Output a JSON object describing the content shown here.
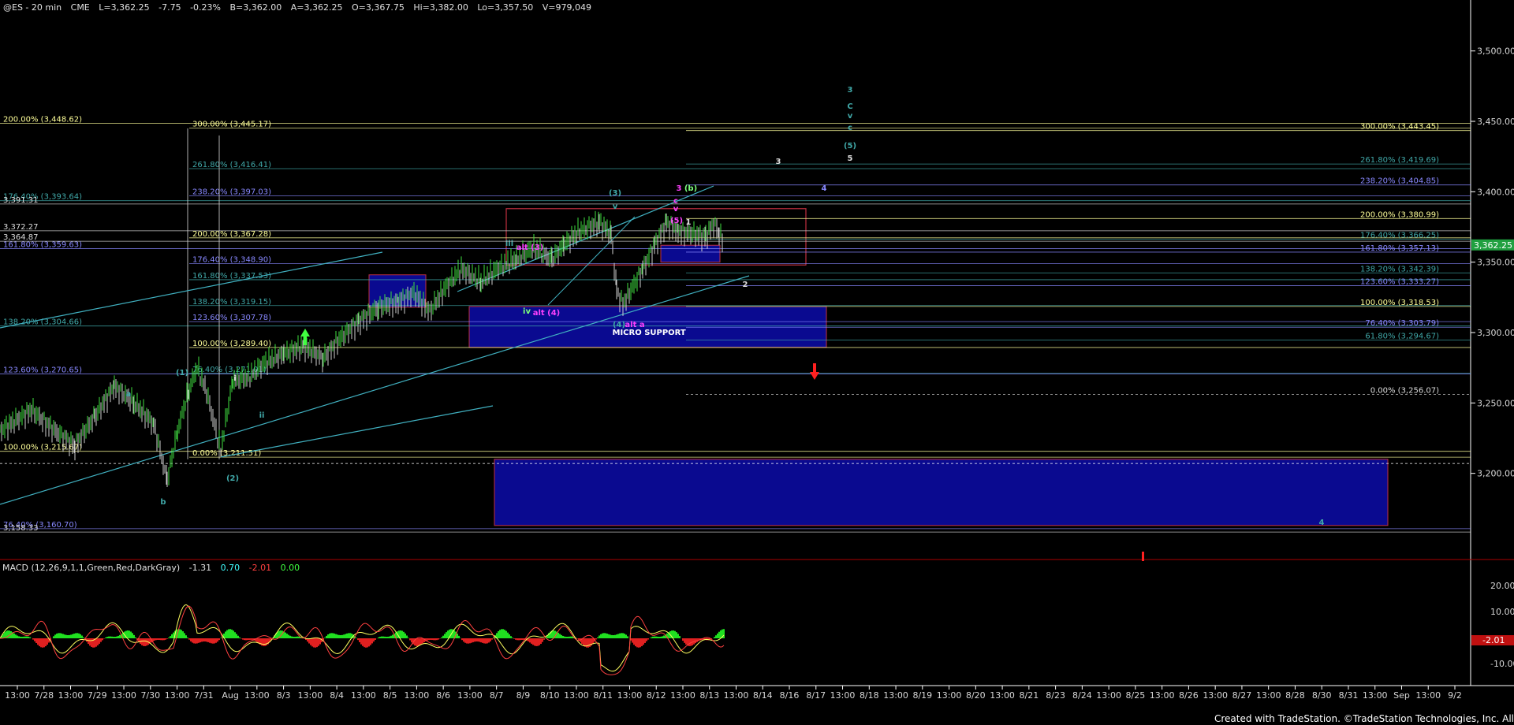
{
  "header": {
    "symbol": "@ES - 20 min",
    "exchange": "CME",
    "last": "L=3,362.25",
    "change": "-7.75",
    "change_pct": "-0.23%",
    "bid": "B=3,362.00",
    "ask": "A=3,362.25",
    "open": "O=3,367.75",
    "high": "Hi=3,382.00",
    "low": "Lo=3,357.50",
    "volume": "V=979,049"
  },
  "footer": {
    "credit": "Created with TradeStation. ©TradeStation Technologies, Inc. All rights reserved."
  },
  "macd": {
    "label": "MACD (12,26,9,1,1,Green,Red,DarkGray)",
    "v1": "-1.31",
    "v2": "0.70",
    "v3": "-2.01",
    "v4": "0.00",
    "current": "-2.01"
  },
  "colors": {
    "fib_yellow": "#ffff99",
    "fib_blue": "#8080ff",
    "fib_teal": "#40a0a0",
    "wave_cyan": "#5fd3e6",
    "wave_magenta": "#ff40ff",
    "wave_green": "#7cff7c",
    "zone_fill": "#0a0a90",
    "zone_border": "#c03040",
    "price_box": "#20a040"
  },
  "chart_data": {
    "type": "line",
    "title": "@ES - 20 min",
    "price_axis": {
      "ylim": [
        3150,
        3525
      ],
      "ticks": [
        "3,500.00",
        "3,450.00",
        "3,400.00",
        "3,350.00",
        "3,300.00",
        "3,250.00",
        "3,200.00"
      ],
      "current_price": "3,362.25"
    },
    "x_axis": {
      "labels": [
        "13:00",
        "7/28",
        "13:00",
        "7/29",
        "13:00",
        "7/30",
        "13:00",
        "7/31",
        "Aug",
        "13:00",
        "8/3",
        "13:00",
        "8/4",
        "13:00",
        "8/5",
        "13:00",
        "8/6",
        "13:00",
        "8/7",
        "8/9",
        "8/10",
        "13:00",
        "8/11",
        "13:00",
        "8/12",
        "13:00",
        "8/13",
        "13:00",
        "8/14",
        "8/16",
        "8/17",
        "13:00",
        "8/18",
        "13:00",
        "8/19",
        "13:00",
        "8/20",
        "13:00",
        "8/21",
        "8/23",
        "8/24",
        "13:00",
        "8/25",
        "13:00",
        "8/26",
        "13:00",
        "8/27",
        "13:00",
        "8/28",
        "8/30",
        "8/31",
        "13:00",
        "Sep",
        "13:00",
        "9/2"
      ]
    },
    "fib_levels": [
      {
        "label": "200.00% (3,448.62)",
        "price": 3448.62,
        "color": "yellow",
        "side": "left"
      },
      {
        "label": "300.00% (3,445.17)",
        "price": 3445.17,
        "color": "yellow",
        "side": "mid"
      },
      {
        "label": "261.80% (3,416.41)",
        "price": 3416.41,
        "color": "teal",
        "side": "mid"
      },
      {
        "label": "238.20% (3,397.03)",
        "price": 3397.03,
        "color": "blue",
        "side": "mid"
      },
      {
        "label": "176.40% (3,393.64)",
        "price": 3393.64,
        "color": "teal",
        "side": "left"
      },
      {
        "label": "3,391.31",
        "price": 3391.31,
        "color": "white",
        "side": "left"
      },
      {
        "label": "3,372.27",
        "price": 3372.27,
        "color": "white",
        "side": "left"
      },
      {
        "label": "200.00% (3,367.28)",
        "price": 3367.28,
        "color": "yellow",
        "side": "mid"
      },
      {
        "label": "3,364.87",
        "price": 3364.87,
        "color": "white",
        "side": "left"
      },
      {
        "label": "161.80% (3,359.63)",
        "price": 3359.63,
        "color": "blue",
        "side": "left"
      },
      {
        "label": "176.40% (3,348.90)",
        "price": 3348.9,
        "color": "blue",
        "side": "mid"
      },
      {
        "label": "161.80% (3,337.53)",
        "price": 3337.53,
        "color": "teal",
        "side": "mid"
      },
      {
        "label": "138.20% (3,319.15)",
        "price": 3319.15,
        "color": "teal",
        "side": "mid"
      },
      {
        "label": "123.60% (3,307.78)",
        "price": 3307.78,
        "color": "blue",
        "side": "mid"
      },
      {
        "label": "138.20% (3,304.66)",
        "price": 3304.66,
        "color": "teal",
        "side": "left"
      },
      {
        "label": "100.00% (3,289.40)",
        "price": 3289.4,
        "color": "yellow",
        "side": "mid"
      },
      {
        "label": "76.40% (3,271.01)",
        "price": 3271.01,
        "color": "teal",
        "side": "mid"
      },
      {
        "label": "123.60% (3,270.65)",
        "price": 3270.65,
        "color": "blue",
        "side": "left"
      },
      {
        "label": "100.00% (3,215.67)",
        "price": 3215.67,
        "color": "yellow",
        "side": "left"
      },
      {
        "label": "0.00% (3,211.51)",
        "price": 3211.51,
        "color": "yellow",
        "side": "mid"
      },
      {
        "label": "76.40% (3,160.70)",
        "price": 3160.7,
        "color": "blue",
        "side": "left"
      },
      {
        "label": "3,158.33",
        "price": 3158.33,
        "color": "white",
        "side": "left"
      },
      {
        "label": "300.00% (3,443.45)",
        "price": 3443.45,
        "color": "yellow",
        "side": "right"
      },
      {
        "label": "261.80% (3,419.69)",
        "price": 3419.69,
        "color": "teal",
        "side": "right"
      },
      {
        "label": "238.20% (3,404.85)",
        "price": 3404.85,
        "color": "blue",
        "side": "right"
      },
      {
        "label": "200.00% (3,380.99)",
        "price": 3380.99,
        "color": "yellow",
        "side": "right"
      },
      {
        "label": "176.40% (3,366.25)",
        "price": 3366.25,
        "color": "teal",
        "side": "right"
      },
      {
        "label": "161.80% (3,357.13)",
        "price": 3357.13,
        "color": "blue",
        "side": "right"
      },
      {
        "label": "138.20% (3,342.39)",
        "price": 3342.39,
        "color": "teal",
        "side": "right"
      },
      {
        "label": "123.60% (3,333.27)",
        "price": 3333.27,
        "color": "blue",
        "side": "right"
      },
      {
        "label": "100.00% (3,318.53)",
        "price": 3318.53,
        "color": "yellow",
        "side": "right"
      },
      {
        "label": "76.40% (3,303.79)",
        "price": 3303.79,
        "color": "blue",
        "side": "right"
      },
      {
        "label": "61.80% (3,294.67)",
        "price": 3294.67,
        "color": "teal",
        "side": "right"
      },
      {
        "label": "0.00% (3,256.07)",
        "price": 3256.07,
        "color": "white",
        "side": "right"
      }
    ],
    "zones": [
      {
        "label": "MICRO SUPPORT",
        "top": 3318.5,
        "bottom": 3289.5
      },
      {
        "label": "",
        "top": 3341,
        "bottom": 3318
      },
      {
        "label": "",
        "top": 3210,
        "bottom": 3163
      }
    ],
    "wave_labels": [
      {
        "text": "3",
        "color": "teal"
      },
      {
        "text": "C",
        "color": "teal"
      },
      {
        "text": "v",
        "color": "teal"
      },
      {
        "text": "c",
        "color": "teal"
      },
      {
        "text": "(5)",
        "color": "teal"
      },
      {
        "text": "5",
        "color": "white"
      },
      {
        "text": "3",
        "color": "white"
      },
      {
        "text": "4",
        "color": "blue"
      },
      {
        "text": "(3)",
        "color": "teal"
      },
      {
        "text": "v",
        "color": "teal"
      },
      {
        "text": "3",
        "color": "magenta"
      },
      {
        "text": "(b)",
        "color": "green"
      },
      {
        "text": "c",
        "color": "magenta"
      },
      {
        "text": "v",
        "color": "magenta"
      },
      {
        "text": "(5)",
        "color": "magenta"
      },
      {
        "text": "1",
        "color": "white"
      },
      {
        "text": "2",
        "color": "white"
      },
      {
        "text": "iii",
        "color": "teal"
      },
      {
        "text": "alt (3)",
        "color": "magenta"
      },
      {
        "text": "iv",
        "color": "green"
      },
      {
        "text": "alt (4)",
        "color": "magenta"
      },
      {
        "text": "(4)",
        "color": "teal"
      },
      {
        "text": "alt a",
        "color": "magenta"
      },
      {
        "text": "(1)",
        "color": "teal"
      },
      {
        "text": "a",
        "color": "teal"
      },
      {
        "text": "b",
        "color": "teal"
      },
      {
        "text": "ii",
        "color": "teal"
      },
      {
        "text": "(2)",
        "color": "teal"
      },
      {
        "text": "i",
        "color": "white"
      },
      {
        "text": "4",
        "color": "teal"
      }
    ]
  }
}
